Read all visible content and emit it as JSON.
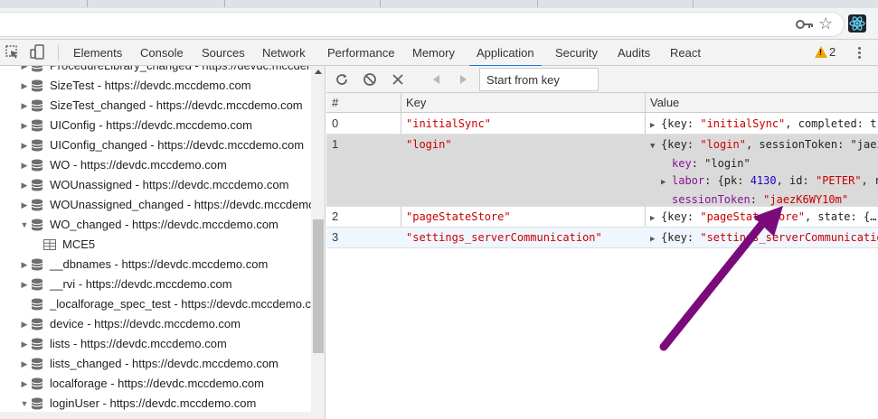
{
  "devtools_tabs": [
    {
      "label": "Elements"
    },
    {
      "label": "Console"
    },
    {
      "label": "Sources"
    },
    {
      "label": "Network"
    },
    {
      "label": "Performance"
    },
    {
      "label": "Memory"
    },
    {
      "label": "Application",
      "active": true
    },
    {
      "label": "Security"
    },
    {
      "label": "Audits"
    },
    {
      "label": "React"
    }
  ],
  "warnings_count": "2",
  "sidebar": {
    "items": [
      {
        "label": "ProcedureLibrary_changed - https://devdc.mccdemo.com",
        "icon": "database-icon",
        "expanded": false
      },
      {
        "label": "SizeTest - https://devdc.mccdemo.com",
        "icon": "database-icon",
        "expanded": false
      },
      {
        "label": "SizeTest_changed - https://devdc.mccdemo.com",
        "icon": "database-icon",
        "expanded": false
      },
      {
        "label": "UIConfig - https://devdc.mccdemo.com",
        "icon": "database-icon",
        "expanded": false
      },
      {
        "label": "UIConfig_changed - https://devdc.mccdemo.com",
        "icon": "database-icon",
        "expanded": false
      },
      {
        "label": "WO - https://devdc.mccdemo.com",
        "icon": "database-icon",
        "expanded": false
      },
      {
        "label": "WOUnassigned - https://devdc.mccdemo.com",
        "icon": "database-icon",
        "expanded": false
      },
      {
        "label": "WOUnassigned_changed - https://devdc.mccdemo.com",
        "icon": "database-icon",
        "expanded": false
      },
      {
        "label": "WO_changed - https://devdc.mccdemo.com",
        "icon": "database-icon",
        "expanded": true
      },
      {
        "label": "MCE5",
        "icon": "object-store-icon",
        "child": true
      },
      {
        "label": "__dbnames - https://devdc.mccdemo.com",
        "icon": "database-icon",
        "expanded": false
      },
      {
        "label": "__rvi - https://devdc.mccdemo.com",
        "icon": "database-icon",
        "expanded": false
      },
      {
        "label": "_localforage_spec_test - https://devdc.mccdemo.com",
        "icon": "database-icon",
        "no_arrow": true
      },
      {
        "label": "device - https://devdc.mccdemo.com",
        "icon": "database-icon",
        "expanded": false
      },
      {
        "label": "lists - https://devdc.mccdemo.com",
        "icon": "database-icon",
        "expanded": false
      },
      {
        "label": "lists_changed - https://devdc.mccdemo.com",
        "icon": "database-icon",
        "expanded": false
      },
      {
        "label": "localforage - https://devdc.mccdemo.com",
        "icon": "database-icon",
        "expanded": false
      },
      {
        "label": "loginUser - https://devdc.mccdemo.com",
        "icon": "database-icon",
        "expanded": true
      }
    ]
  },
  "subtoolbar": {
    "start_placeholder": "Start from key"
  },
  "table": {
    "headers": {
      "index": "#",
      "key": "Key",
      "value": "Value"
    },
    "rows": [
      {
        "index": "0",
        "key": "\"initialSync\"",
        "value_open": "{key: ",
        "value_key": "\"initialSync\"",
        "value_rest": ", completed: tr"
      },
      {
        "index": "1",
        "key": "\"login\"",
        "value_open": "{key: ",
        "value_key": "\"login\"",
        "value_rest": ", sessionToken: \"jaez",
        "expanded": {
          "key_label": "key",
          "key_value": "\"login\"",
          "labor_label": "labor",
          "labor_open": "{pk: ",
          "labor_pk": "4130",
          "labor_mid": ", id: ",
          "labor_id": "\"PETER\"",
          "labor_tail": ", r",
          "session_label": "sessionToken",
          "session_value": "\"jaezK6WY10m\""
        }
      },
      {
        "index": "2",
        "key": "\"pageStateStore\"",
        "value_open": "{key: ",
        "value_key": "\"pageStateStore\"",
        "value_rest": ", state: {…"
      },
      {
        "index": "3",
        "key": "\"settings_serverCommunication\"",
        "value_open": "{key: ",
        "value_key": "\"settings_serverCommunicatio",
        "value_rest": ""
      }
    ]
  },
  "annotation_color": "#7b0a7b"
}
